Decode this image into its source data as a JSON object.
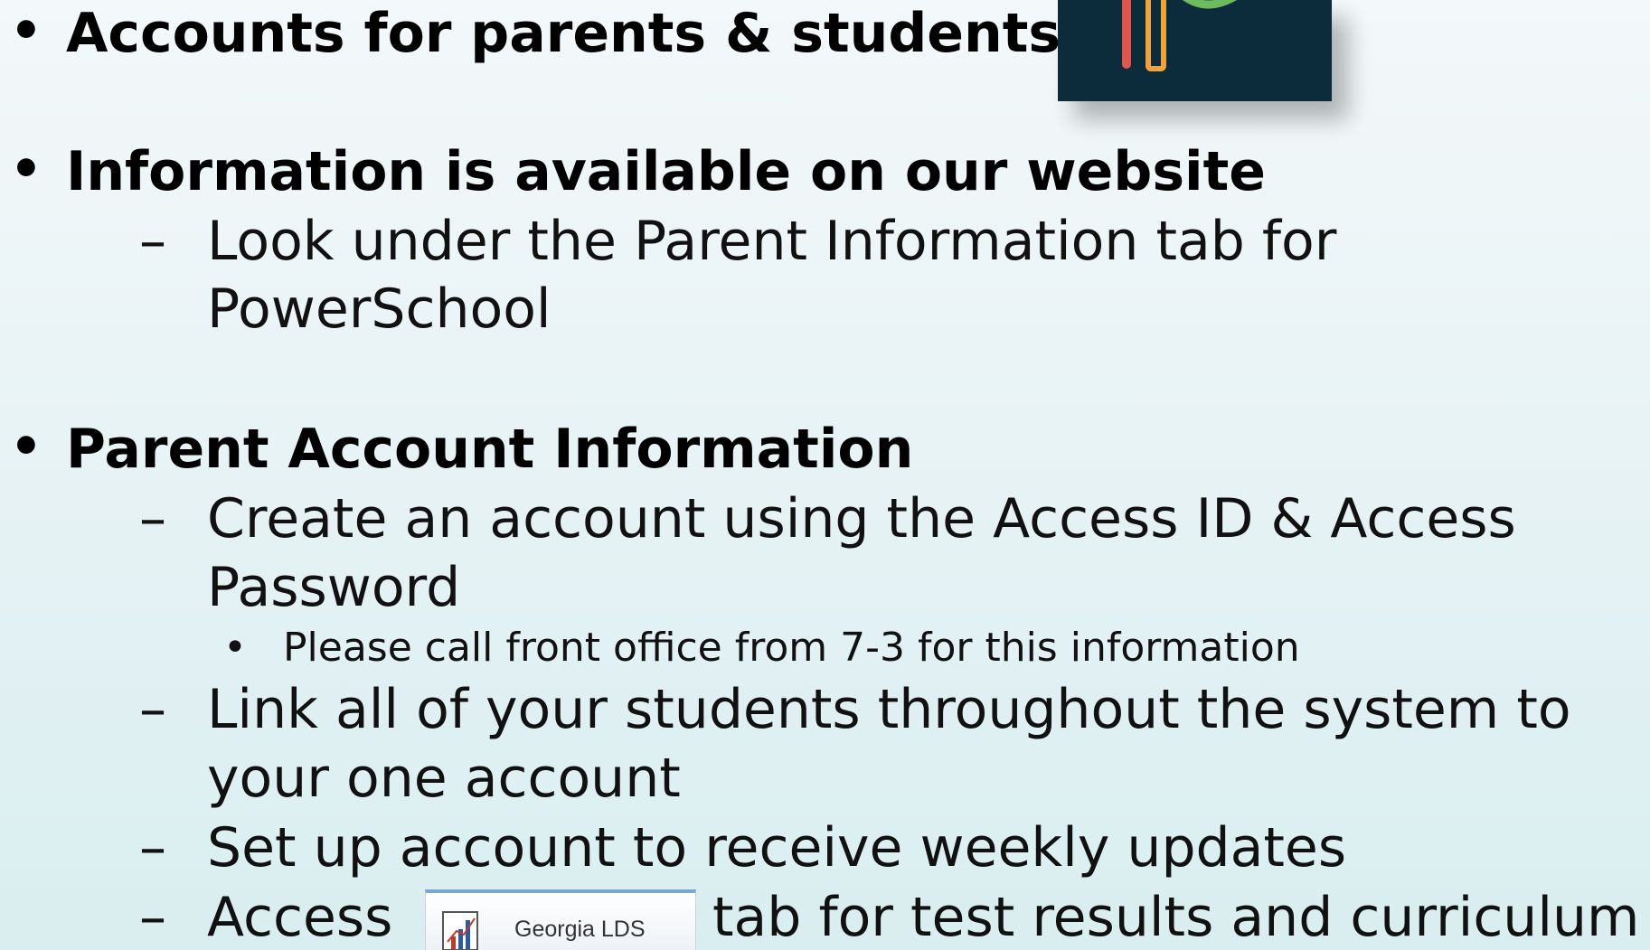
{
  "bullets": {
    "b1": "Accounts for parents & students",
    "b2": "Information is available on our website",
    "b2_sub1_line1": "Look under the Parent Information tab for",
    "b2_sub1_line2": "PowerSchool",
    "b3": "Parent Account Information",
    "b3_sub1_line1": "Create an account using the Access ID & Access",
    "b3_sub1_line2": "Password",
    "b3_sub1_sub1": "Please call front office from 7-3 for this information",
    "b3_sub2_line1": "Link all of your students throughout the system to",
    "b3_sub2_line2": "your one account",
    "b3_sub3": "Set up account to receive weekly updates",
    "b3_sub4_pre": "Access",
    "b3_sub4_post": "tab for test results and curriculum"
  },
  "markers": {
    "bullet": "•",
    "dash": "–",
    "small_bullet": "•"
  },
  "lds_tab": {
    "label": "Georgia LDS",
    "icon": "bar-chart-icon"
  },
  "logo": {
    "icon": "powerschool-logo-icon"
  },
  "colors": {
    "logo_bg": "#0c2b3b",
    "tab_border": "#7aa7cf"
  }
}
